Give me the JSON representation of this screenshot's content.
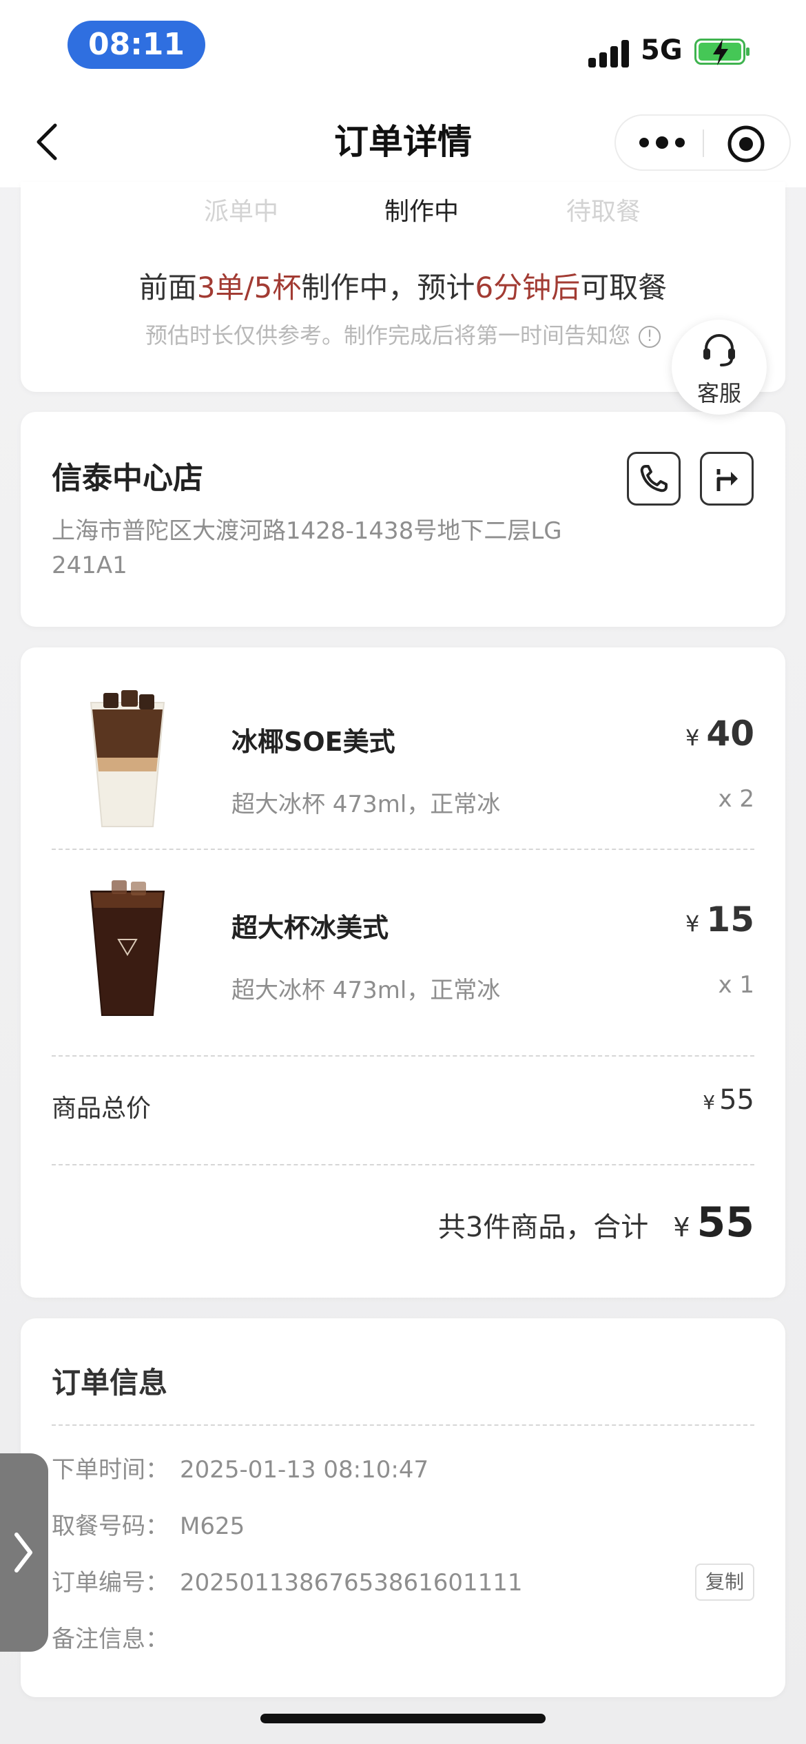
{
  "status_bar": {
    "time": "08:11",
    "network": "5G",
    "icons": [
      "signal-icon",
      "battery-charging-icon"
    ]
  },
  "nav": {
    "title": "订单详情",
    "icons": [
      "chevron-left-icon",
      "more-dots-icon",
      "target-close-icon"
    ]
  },
  "progress": {
    "steps": [
      "派单中",
      "制作中",
      "待取餐"
    ],
    "active_step": 1,
    "message": {
      "prefix": "前面",
      "queue": "3单/5杯",
      "middle": "制作中，预计",
      "eta": "6分钟后",
      "suffix": "可取餐"
    },
    "note": "预估时长仅供参考。制作完成后将第一时间告知您",
    "highlight_color": "#a23b33"
  },
  "customer_service": {
    "label": "客服",
    "icon": "headset-icon"
  },
  "store": {
    "name": "信泰中心店",
    "address": "上海市普陀区大渡河路1428-1438号地下二层LG 241A1",
    "icons": [
      "phone-icon",
      "directions-icon"
    ]
  },
  "items": [
    {
      "name": "冰椰SOE美式",
      "spec": "超大冰杯 473ml，正常冰",
      "currency": "¥",
      "price": "40",
      "qty": "x 2",
      "icon": "iced-coconut-coffee-image"
    },
    {
      "name": "超大杯冰美式",
      "spec": "超大冰杯 473ml，正常冰",
      "currency": "¥",
      "price": "15",
      "qty": "x 1",
      "icon": "iced-americano-image"
    }
  ],
  "summary": {
    "subtotal_label": "商品总价",
    "currency": "¥",
    "subtotal": "55",
    "total_prefix": "共3件商品，合计",
    "total": "55"
  },
  "order_info": {
    "title": "订单信息",
    "rows": [
      {
        "label": "下单时间：",
        "value": "2025-01-13 08:10:47"
      },
      {
        "label": "取餐号码：",
        "value": "M625"
      },
      {
        "label": "订单编号：",
        "value": "20250113867653861601111"
      },
      {
        "label": "备注信息：",
        "value": ""
      }
    ],
    "copy_label": "复制"
  },
  "side_handle": {
    "icon": "chevron-right-icon"
  }
}
